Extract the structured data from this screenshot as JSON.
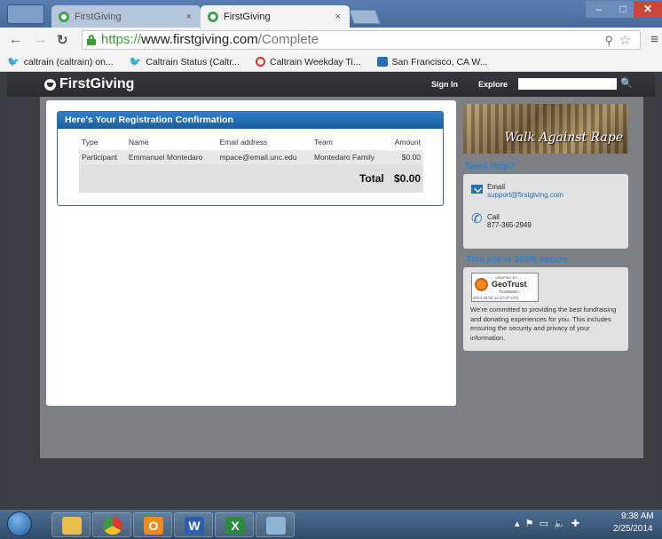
{
  "browser": {
    "tabs": [
      {
        "title": "FirstGiving",
        "close": "×"
      },
      {
        "title": "FirstGiving",
        "close": "×"
      }
    ],
    "url": {
      "scheme": "https://",
      "host": "www.firstgiving.com",
      "path": "/Complete"
    },
    "bookmarks": [
      {
        "label": "caltrain (caltrain) on...",
        "icon": "twitter-icon"
      },
      {
        "label": "Caltrain Status (Caltr...",
        "icon": "twitter-icon"
      },
      {
        "label": "Caltrain Weekday Ti...",
        "icon": "clock-icon"
      },
      {
        "label": "San Francisco, CA W...",
        "icon": "weather-icon"
      }
    ]
  },
  "site": {
    "logo": "FirstGiving",
    "nav": {
      "sign_in": "Sign In",
      "explore": "Explore"
    },
    "search": {
      "value": "",
      "placeholder": ""
    }
  },
  "confirmation": {
    "title": "Here's Your Registration Confirmation",
    "columns": [
      "Type",
      "Name",
      "Email address",
      "Team",
      "Amount"
    ],
    "rows": [
      {
        "type": "Participant",
        "name": "Emmanuel Montedaro",
        "email": "mpace@email.unc.edu",
        "team": "Montedaro Family",
        "amount": "$0.00"
      }
    ],
    "total_label": "Total",
    "total_value": "$0.00"
  },
  "sidebar": {
    "banner_text": "Walk Against Rape",
    "need_help": {
      "heading": "Need Help?",
      "email_label": "Email",
      "email_value": "support@firstgiving.com",
      "call_label": "Call",
      "call_value": "877-365-2949"
    },
    "secure": {
      "heading": "This site is 100% secure",
      "badge": {
        "small": "VERIFIED BY",
        "name": "GeoTrust",
        "sub": "TrustWatch...",
        "date": "2014 25 02 14:17:37 UTC"
      },
      "text": "We're committed to providing the best fundraising and donating experiences for you. This includes ensuring the security and privacy of your information."
    }
  },
  "taskbar": {
    "time": "9:38 AM",
    "date": "2/25/2014"
  }
}
